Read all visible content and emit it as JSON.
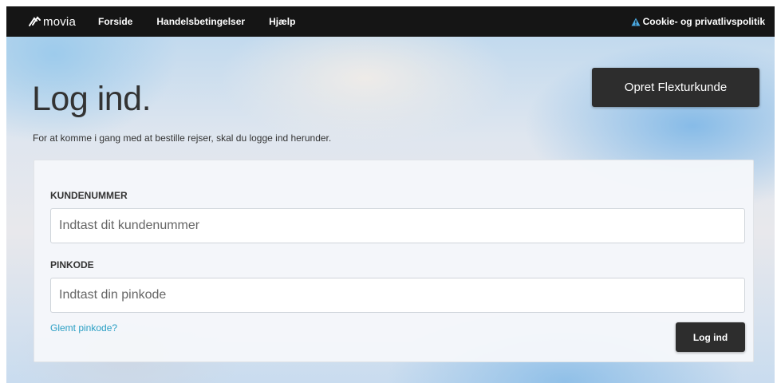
{
  "nav": {
    "brand": "movia",
    "links": [
      "Forside",
      "Handelsbetingelser",
      "Hjælp"
    ],
    "cookie_link": "Cookie- og privatlivspolitik",
    "cookie_icon": "warning-triangle-icon"
  },
  "header": {
    "title": "Log ind.",
    "intro": "For at komme i gang med at bestille rejser, skal du logge ind herunder.",
    "create_button": "Opret Flexturkunde"
  },
  "form": {
    "customer_label": "KUNDENUMMER",
    "customer_placeholder": "Indtast dit kundenummer",
    "customer_value": "",
    "pin_label": "PINKODE",
    "pin_placeholder": "Indtast din pinkode",
    "pin_value": "",
    "forgot_link": "Glemt pinkode?",
    "login_button": "Log ind"
  },
  "colors": {
    "navbar": "#151515",
    "button": "#2d2d2d",
    "link": "#2a9fc4",
    "warning": "#4aa8e0"
  }
}
